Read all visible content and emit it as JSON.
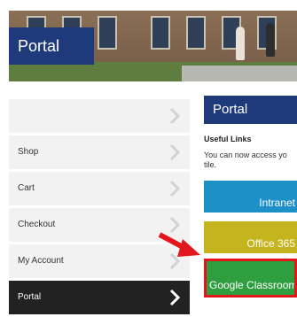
{
  "hero": {
    "title": "Portal"
  },
  "menu": {
    "items": [
      {
        "label": ""
      },
      {
        "label": "Shop"
      },
      {
        "label": "Cart"
      },
      {
        "label": "Checkout"
      },
      {
        "label": "My Account"
      },
      {
        "label": "Portal"
      }
    ]
  },
  "right_panel": {
    "heading": "Portal",
    "useful_links": "Useful Links",
    "description": "You can now access yo tile.",
    "tiles": {
      "intranet": "Intranet",
      "office365": "Office 365",
      "google_classroom": "Google Classroom"
    }
  },
  "colors": {
    "navy": "#1f3a7a",
    "menu_bg": "#f2f2f2",
    "menu_active": "#222222",
    "intranet_blue": "#1e90c8",
    "office_yellow": "#c6b41f",
    "classroom_green": "#2f9e3f",
    "highlight_red": "#e3161b"
  },
  "icons": {
    "chevron": "chevron-right-icon",
    "arrow": "red-arrow-icon"
  }
}
